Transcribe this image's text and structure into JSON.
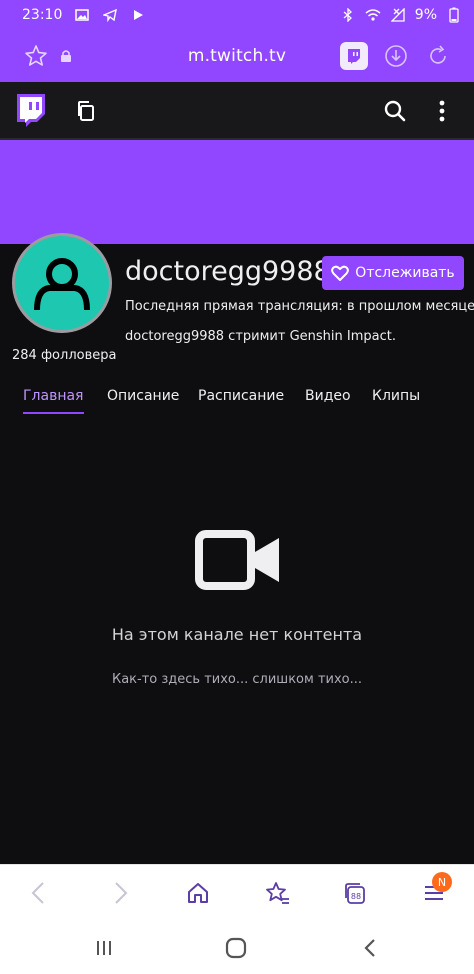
{
  "status_bar": {
    "time": "23:10",
    "battery": "9%"
  },
  "browser": {
    "url": "m.twitch.tv"
  },
  "channel": {
    "name": "doctoregg9988",
    "follow_label": "Отслеживать",
    "last_live": "Последняя прямая трансляция: в прошлом месяце",
    "streams": "doctoregg9988 стримит Genshin Impact.",
    "followers": "284 фолловера"
  },
  "tabs": [
    {
      "label": "Главная"
    },
    {
      "label": "Описание"
    },
    {
      "label": "Расписание"
    },
    {
      "label": "Видео"
    },
    {
      "label": "Клипы"
    }
  ],
  "empty_state": {
    "title": "На этом канале нет контента",
    "subtitle": "Как-то здесь тихо... слишком тихо..."
  },
  "bottom_nav": {
    "badge": "N"
  },
  "colors": {
    "brand": "#9147ff",
    "background": "#0e0e10",
    "avatar": "#1ec7b0",
    "badge": "#ff6a1a"
  },
  "icons": [
    "gallery-icon",
    "telegram-icon",
    "play-icon",
    "bluetooth-icon",
    "wifi-icon",
    "signal-icon",
    "battery-icon",
    "bookmark-star-icon",
    "lock-icon",
    "twitch-icon",
    "download-icon",
    "reload-icon",
    "twitch-logo-icon",
    "browse-icon",
    "search-icon",
    "more-icon",
    "heart-icon",
    "video-camera-icon",
    "back-icon",
    "forward-icon",
    "home-icon",
    "bookmarks-icon",
    "tabs-icon",
    "menu-icon",
    "recents-icon",
    "home-button-icon",
    "back-nav-icon"
  ]
}
